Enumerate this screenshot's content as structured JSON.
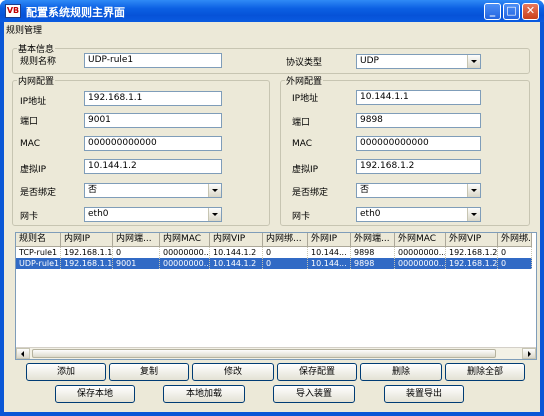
{
  "window": {
    "title": "配置系统规则主界面",
    "icon_text": "VB"
  },
  "menu": {
    "rule_mgmt": "规则管理"
  },
  "basic": {
    "group_label": "基本信息",
    "rule_name_label": "规则名称",
    "rule_name_value": "UDP-rule1",
    "protocol_label": "协议类型",
    "protocol_value": "UDP"
  },
  "inner": {
    "group_label": "内网配置",
    "ip_label": "IP地址",
    "ip_value": "192.168.1.1",
    "port_label": "端口",
    "port_value": "9001",
    "mac_label": "MAC",
    "mac_value": "000000000000",
    "vip_label": "虚拟IP",
    "vip_value": "10.144.1.2",
    "bind_label": "是否绑定",
    "bind_value": "否",
    "nic_label": "网卡",
    "nic_value": "eth0"
  },
  "outer": {
    "group_label": "外网配置",
    "ip_label": "IP地址",
    "ip_value": "10.144.1.1",
    "port_label": "端口",
    "port_value": "9898",
    "mac_label": "MAC",
    "mac_value": "000000000000",
    "vip_label": "虚拟IP",
    "vip_value": "192.168.1.2",
    "bind_label": "是否绑定",
    "bind_value": "否",
    "nic_label": "网卡",
    "nic_value": "eth0"
  },
  "table": {
    "columns": [
      "规则名",
      "内网IP",
      "内网端...",
      "内网MAC",
      "内网VIP",
      "内网绑...",
      "外网IP",
      "外网端...",
      "外网MAC",
      "外网VIP",
      "外网绑..."
    ],
    "rows": [
      [
        "TCP-rule1",
        "192.168.1.1",
        "0",
        "00000000...",
        "10.144.1.2",
        "0",
        "10.144...",
        "9898",
        "00000000...",
        "192.168.1.2",
        "0"
      ],
      [
        "UDP-rule1",
        "192.168.1.1",
        "9001",
        "00000000...",
        "10.144.1.2",
        "0",
        "10.144...",
        "9898",
        "00000000...",
        "192.168.1.2",
        "0"
      ]
    ],
    "selected_row": 1
  },
  "buttons": {
    "add": "添加",
    "copy": "复制",
    "modify": "修改",
    "save_config": "保存配置",
    "delete": "删除",
    "delete_all": "删除全部",
    "save_local": "保存本地",
    "load_local": "本地加载",
    "import_device": "导入装置",
    "export_device": "装置导出"
  },
  "colors": {
    "titlebar": "#0a57d6",
    "selection": "#316ac5",
    "face": "#ece9d8"
  }
}
